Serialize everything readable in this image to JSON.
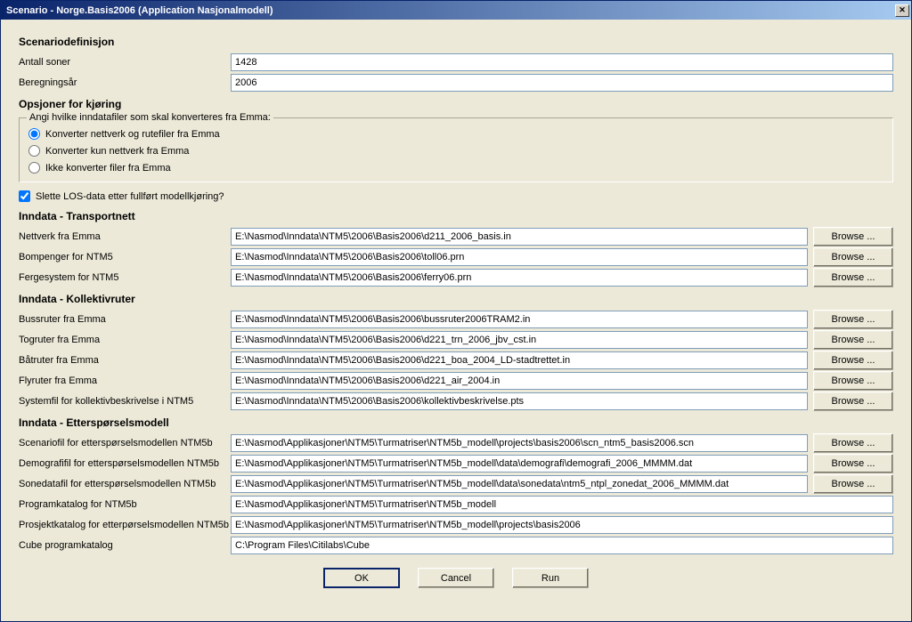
{
  "window": {
    "title": "Scenario - Norge.Basis2006 (Application Nasjonalmodell)"
  },
  "sections": {
    "def": {
      "heading": "Scenariodefinisjon",
      "zones_label": "Antall soner",
      "zones_value": "1428",
      "year_label": "Beregningsår",
      "year_value": "2006"
    },
    "opts": {
      "heading": "Opsjoner for kjøring",
      "group_legend": "Angi hvilke inndatafiler som skal konverteres fra Emma:",
      "radio1": "Konverter nettverk og rutefiler fra Emma",
      "radio2": "Konverter kun nettverk fra Emma",
      "radio3": "Ikke konverter filer fra Emma",
      "check_los": "Slette LOS-data etter fullført modellkjøring?"
    },
    "transport": {
      "heading": "Inndata - Transportnett",
      "net_label": "Nettverk fra Emma",
      "net_value": "E:\\Nasmod\\Inndata\\NTM5\\2006\\Basis2006\\d211_2006_basis.in",
      "toll_label": "Bompenger for NTM5",
      "toll_value": "E:\\Nasmod\\Inndata\\NTM5\\2006\\Basis2006\\toll06.prn",
      "ferry_label": "Fergesystem for NTM5",
      "ferry_value": "E:\\Nasmod\\Inndata\\NTM5\\2006\\Basis2006\\ferry06.prn"
    },
    "kollektiv": {
      "heading": "Inndata - Kollektivruter",
      "bus_label": "Bussruter fra Emma",
      "bus_value": "E:\\Nasmod\\Inndata\\NTM5\\2006\\Basis2006\\bussruter2006TRAM2.in",
      "train_label": "Togruter fra Emma",
      "train_value": "E:\\Nasmod\\Inndata\\NTM5\\2006\\Basis2006\\d221_trn_2006_jbv_cst.in",
      "boat_label": "Båtruter fra Emma",
      "boat_value": "E:\\Nasmod\\Inndata\\NTM5\\2006\\Basis2006\\d221_boa_2004_LD-stadtrettet.in",
      "air_label": "Flyruter fra Emma",
      "air_value": "E:\\Nasmod\\Inndata\\NTM5\\2006\\Basis2006\\d221_air_2004.in",
      "sys_label": "Systemfil for kollektivbeskrivelse i NTM5",
      "sys_value": "E:\\Nasmod\\Inndata\\NTM5\\2006\\Basis2006\\kollektivbeskrivelse.pts"
    },
    "demand": {
      "heading": "Inndata - Etterspørselsmodell",
      "scn_label": "Scenariofil for etterspørselsmodellen NTM5b",
      "scn_value": "E:\\Nasmod\\Applikasjoner\\NTM5\\Turmatriser\\NTM5b_modell\\projects\\basis2006\\scn_ntm5_basis2006.scn",
      "demo_label": "Demografifil for etterspørselsmodellen NTM5b",
      "demo_value": "E:\\Nasmod\\Applikasjoner\\NTM5\\Turmatriser\\NTM5b_modell\\data\\demografi\\demografi_2006_MMMM.dat",
      "sone_label": "Sonedatafil for etterspørselsmodellen NTM5b",
      "sone_value": "E:\\Nasmod\\Applikasjoner\\NTM5\\Turmatriser\\NTM5b_modell\\data\\sonedata\\ntm5_ntpl_zonedat_2006_MMMM.dat",
      "prog_label": "Programkatalog for NTM5b",
      "prog_value": "E:\\Nasmod\\Applikasjoner\\NTM5\\Turmatriser\\NTM5b_modell",
      "proj_label": "Prosjektkatalog for etterpørselsmodellen NTM5b",
      "proj_value": "E:\\Nasmod\\Applikasjoner\\NTM5\\Turmatriser\\NTM5b_modell\\projects\\basis2006",
      "cube_label": "Cube programkatalog",
      "cube_value": "C:\\Program Files\\Citilabs\\Cube"
    }
  },
  "buttons": {
    "browse": "Browse ...",
    "ok": "OK",
    "cancel": "Cancel",
    "run": "Run"
  }
}
